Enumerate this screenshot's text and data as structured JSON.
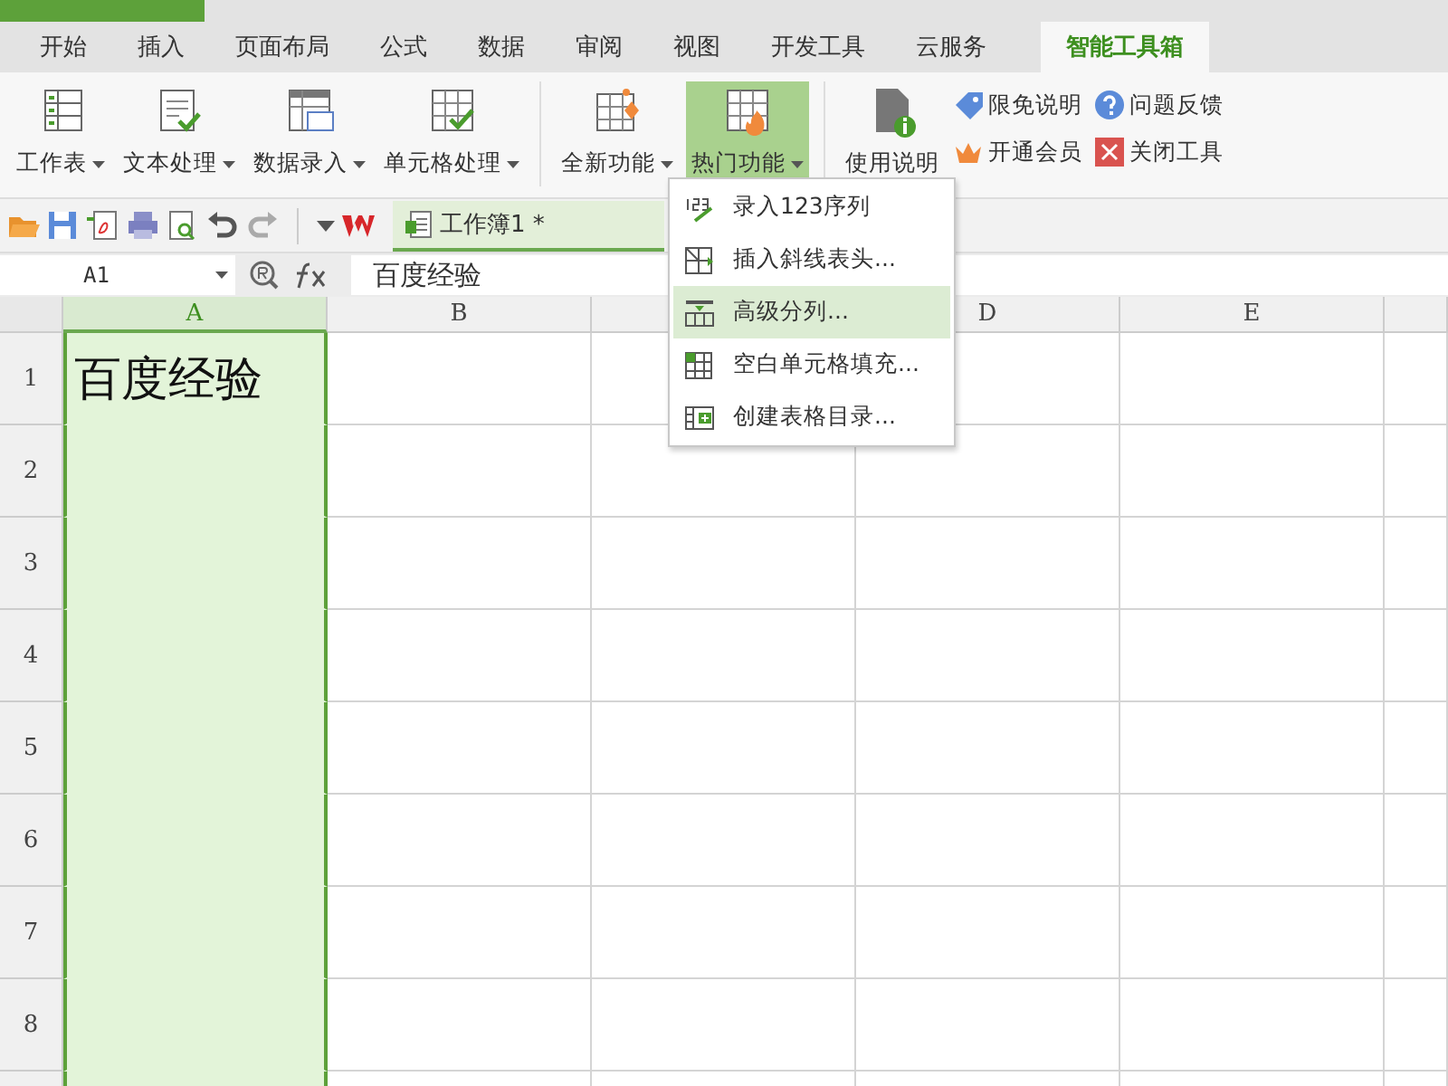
{
  "tabs": [
    {
      "label": "开始",
      "selected": false
    },
    {
      "label": "插入",
      "selected": false
    },
    {
      "label": "页面布局",
      "selected": false
    },
    {
      "label": "公式",
      "selected": false
    },
    {
      "label": "数据",
      "selected": false
    },
    {
      "label": "审阅",
      "selected": false
    },
    {
      "label": "视图",
      "selected": false
    },
    {
      "label": "开发工具",
      "selected": false
    },
    {
      "label": "云服务",
      "selected": false
    },
    {
      "label": "智能工具箱",
      "selected": true
    }
  ],
  "ribbon": {
    "groups": [
      {
        "separator": false,
        "items": [
          {
            "kind": "large",
            "label": "工作表",
            "dropdown": true,
            "pressed": false
          },
          {
            "kind": "large",
            "label": "文本处理",
            "dropdown": true,
            "pressed": false
          },
          {
            "kind": "large",
            "label": "数据录入",
            "dropdown": true,
            "pressed": false
          },
          {
            "kind": "large",
            "label": "单元格处理",
            "dropdown": true,
            "pressed": false
          }
        ]
      },
      {
        "separator": true,
        "items": [
          {
            "kind": "large",
            "label": "全新功能",
            "dropdown": true,
            "pressed": false
          },
          {
            "kind": "large",
            "label": "热门功能",
            "dropdown": true,
            "pressed": true
          }
        ]
      },
      {
        "separator": true,
        "items": [
          {
            "kind": "large",
            "label": "使用说明",
            "dropdown": false,
            "pressed": false
          }
        ]
      },
      {
        "separator": false,
        "items": [
          {
            "kind": "small",
            "label": "限免说明"
          },
          {
            "kind": "small",
            "label": "问题反馈"
          },
          {
            "kind": "small",
            "label": "开通会员"
          },
          {
            "kind": "small",
            "label": "关闭工具"
          }
        ]
      }
    ]
  },
  "doc_tab": {
    "title": "工作簿1 *",
    "selected": true
  },
  "name_box": "A1",
  "formula": "百度经验",
  "columns": [
    {
      "label": "A",
      "selected": true
    },
    {
      "label": "B",
      "selected": false
    },
    {
      "selected": false
    },
    {
      "label": "D",
      "selected": false
    },
    {
      "label": "E",
      "selected": false
    }
  ],
  "rows": [
    {
      "label": "1",
      "cells": [
        "百度经验"
      ]
    },
    {
      "label": "2"
    },
    {
      "label": "3"
    },
    {
      "label": "4"
    },
    {
      "label": "5"
    },
    {
      "label": "6"
    },
    {
      "label": "7"
    },
    {
      "label": "8"
    }
  ],
  "menu": [
    {
      "label": "录入123序列",
      "selected": false
    },
    {
      "label": "插入斜线表头...",
      "selected": false
    },
    {
      "label": "高级分列...",
      "selected": true
    },
    {
      "label": "空白单元格填充...",
      "selected": false
    },
    {
      "label": "创建表格目录...",
      "selected": false
    }
  ]
}
